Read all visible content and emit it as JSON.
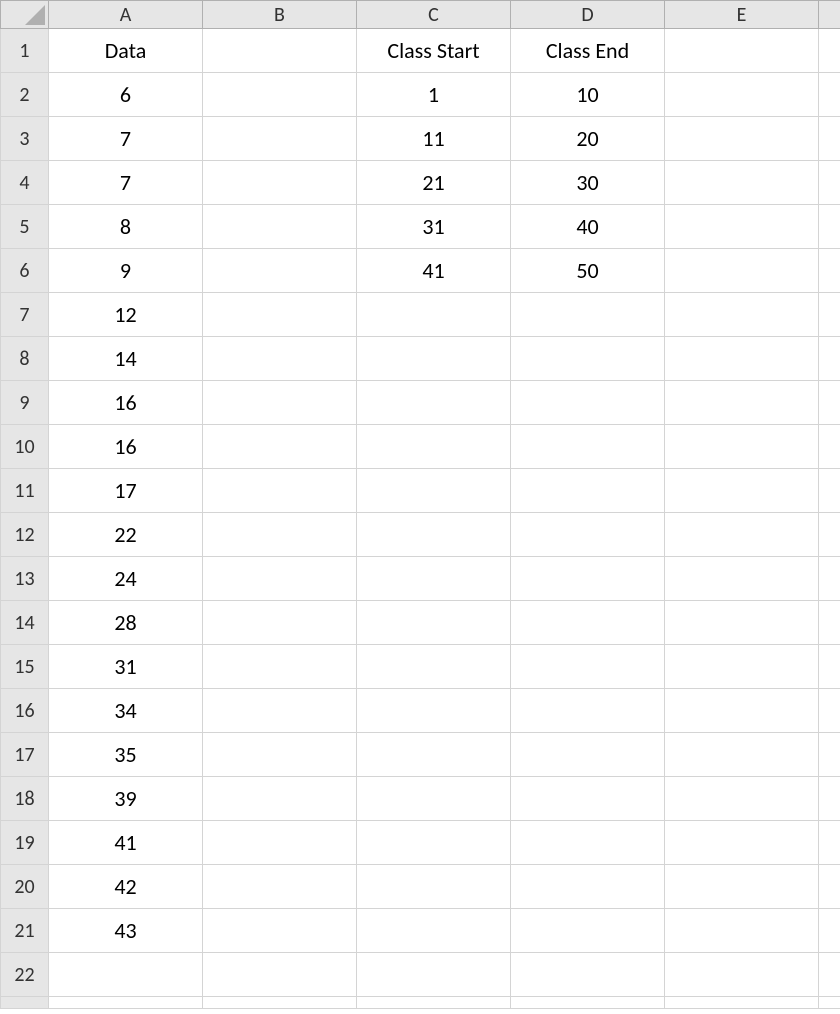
{
  "columns": {
    "corner": "",
    "A": "A",
    "B": "B",
    "C": "C",
    "D": "D",
    "E": "E"
  },
  "rowLabels": {
    "1": "1",
    "2": "2",
    "3": "3",
    "4": "4",
    "5": "5",
    "6": "6",
    "7": "7",
    "8": "8",
    "9": "9",
    "10": "10",
    "11": "11",
    "12": "12",
    "13": "13",
    "14": "14",
    "15": "15",
    "16": "16",
    "17": "17",
    "18": "18",
    "19": "19",
    "20": "20",
    "21": "21",
    "22": "22"
  },
  "cells": {
    "A1": "Data",
    "C1": "Class Start",
    "D1": "Class End",
    "A2": "6",
    "C2": "1",
    "D2": "10",
    "A3": "7",
    "C3": "11",
    "D3": "20",
    "A4": "7",
    "C4": "21",
    "D4": "30",
    "A5": "8",
    "C5": "31",
    "D5": "40",
    "A6": "9",
    "C6": "41",
    "D6": "50",
    "A7": "12",
    "A8": "14",
    "A9": "16",
    "A10": "16",
    "A11": "17",
    "A12": "22",
    "A13": "24",
    "A14": "28",
    "A15": "31",
    "A16": "34",
    "A17": "35",
    "A18": "39",
    "A19": "41",
    "A20": "42",
    "A21": "43"
  }
}
